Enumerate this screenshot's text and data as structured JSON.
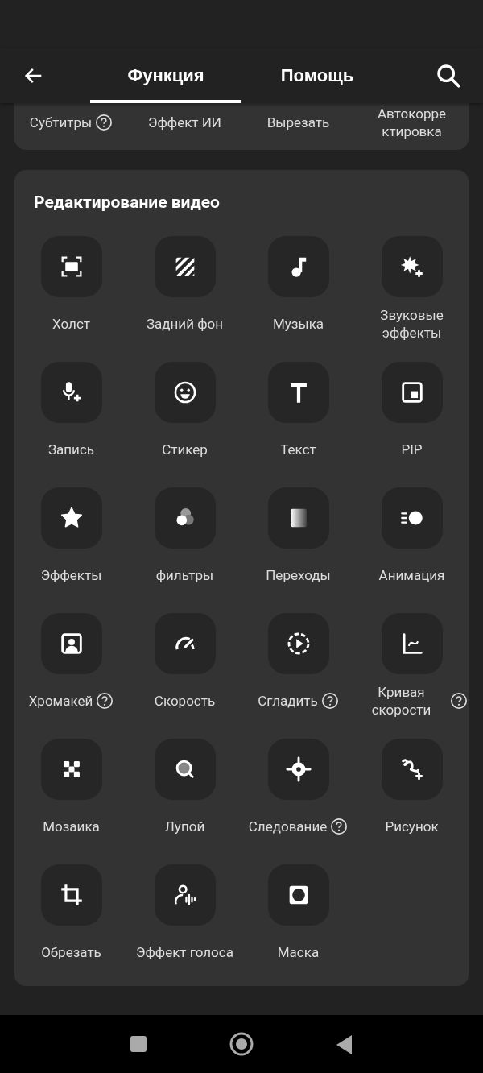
{
  "header": {
    "tabs": [
      {
        "label": "Функция",
        "selected": true
      },
      {
        "label": "Помощь",
        "selected": false
      }
    ]
  },
  "top_tools": [
    {
      "label": "Субтитры",
      "help": true
    },
    {
      "label": "Эффект ИИ",
      "help": false
    },
    {
      "label": "Вырезать",
      "help": false
    },
    {
      "label": "Автокорректировка",
      "help": false
    }
  ],
  "video_editing": {
    "title": "Редактирование видео",
    "tools": [
      {
        "label": "Холст",
        "help": false
      },
      {
        "label": "Задний фон",
        "help": false
      },
      {
        "label": "Музыка",
        "help": false
      },
      {
        "label": "Звуковые эффекты",
        "help": false
      },
      {
        "label": "Запись",
        "help": false
      },
      {
        "label": "Стикер",
        "help": false
      },
      {
        "label": "Текст",
        "help": false
      },
      {
        "label": "PIP",
        "help": false
      },
      {
        "label": "Эффекты",
        "help": false
      },
      {
        "label": "фильтры",
        "help": false
      },
      {
        "label": "Переходы",
        "help": false
      },
      {
        "label": "Анимация",
        "help": false
      },
      {
        "label": "Хромакей",
        "help": true
      },
      {
        "label": "Скорость",
        "help": false
      },
      {
        "label": "Сгладить",
        "help": true
      },
      {
        "label": "Кривая скорости",
        "help": true
      },
      {
        "label": "Мозаика",
        "help": false
      },
      {
        "label": "Лупой",
        "help": false
      },
      {
        "label": "Следование",
        "help": true
      },
      {
        "label": "Рисунок",
        "help": false
      },
      {
        "label": "Обрезать",
        "help": false
      },
      {
        "label": "Эффект голоса",
        "help": false
      },
      {
        "label": "Маска",
        "help": false
      }
    ]
  }
}
